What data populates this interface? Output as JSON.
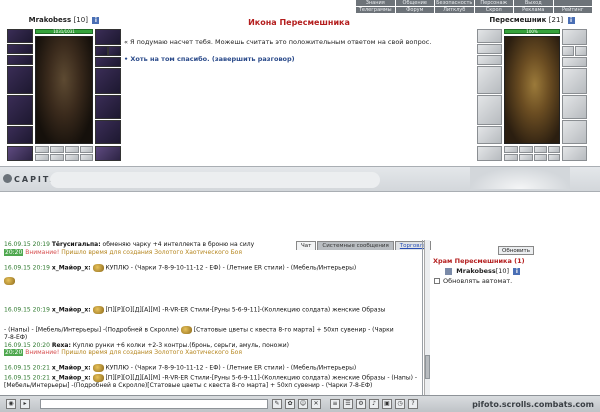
{
  "top_menu": {
    "row1": [
      "Знания",
      "Общение",
      "Безопасность",
      "Персонаж",
      "Выход",
      ""
    ],
    "row2": [
      "Телеграммы",
      "Форум",
      "Литклуб",
      "Скрол",
      "Реклама",
      "Рейтинг"
    ]
  },
  "player": {
    "name": "Mrakobess",
    "level": "[10]",
    "hp": "1031/1031",
    "info_icon": "info-icon"
  },
  "npc": {
    "name": "Пересмешник",
    "level": "[21]",
    "hp": "100%",
    "info_icon": "info-icon"
  },
  "dialog": {
    "title": "Икона Пересмешника",
    "text": "Я подумаю насчет тебя. Можешь считать это положительным ответом на свой вопрос.",
    "answer": "Хоть на том спасибо. (завершить разговор)"
  },
  "banner": {
    "logo": "CAPITALCITY"
  },
  "chat": {
    "tabs": [
      "Чат",
      "Системные сообщения",
      "Торговля"
    ],
    "messages": [
      {
        "time": "16.09.15 20:19",
        "nick": "Tёrycигaльпа:",
        "text": "обменяю чарку +4 интеллекта в броню на силу"
      },
      {
        "time": "20:20",
        "system": "Внимание!",
        "text": "Пришло время для создания Золотого Хаотического Боя"
      },
      {
        "time": "16.09.15 20:19",
        "nick": "x_Майор_x:",
        "text": "КУПЛЮ - (Чарки 7-8-9-10-11-12 - ЕФ) - (Летние ЕR стили) - (Мебель/Интерьеры)"
      },
      {
        "time": "16.09.15 20:19",
        "nick": "x_Майор_x:",
        "text": "[П][Р][О][Д][А][М] -R-VR-ER Стили-[Руны 5-6-9-11]-(Коллекцию солдата) женские Образы"
      },
      {
        "text": "- (Напы) - [Мебель/Интерьеры] -(Подробней в Скролле)"
      },
      {
        "text": "[Статовые цветы с квеста 8-го марта] + 50хп сувенир - (Чарки"
      },
      {
        "text": "7-8-ЕФ)"
      },
      {
        "time": "16.09.15 20:20",
        "nick": "Rexa:",
        "text": "Куплю рунки +6 колки +2-3 контры.(бронь, серьги, амуль, поножи)"
      },
      {
        "time": "20:20",
        "system": "Внимание!",
        "text": "Пришло время для создания Золотого Хаотического Боя"
      },
      {
        "time": "16.09.15 20:21",
        "nick": "x_Майор_x:",
        "text": "КУПЛЮ - (Чарки 7-8-9-10-11-12 - ЕФ) - (Летние ЕR стили) - (Мебель/Интерьеры)"
      },
      {
        "time": "16.09.15 20:21",
        "nick": "x_Майор_x:",
        "text": "[П][Р][О][Д][А][М] -R-VR-ER Стили-[Руны 5-6-9-11]-(Коллекцию солдата) женские Образы - (Напы) -"
      },
      {
        "text": "[Мебель/Интерьеры] -(Подробней в Скролле)[Статовые цветы с квеста 8-го марта] + 50хп сувенир - (Чарки 7-8-ЕФ)"
      }
    ]
  },
  "side": {
    "refresh_label": "Обновить",
    "room": "Храм Пересмешника (1)",
    "online_name": "Mrakobess",
    "online_level": "[10]",
    "auto_label": "Обновлять автомат."
  },
  "footer": {
    "watermark": "pifoto.scrolls.combats.com"
  }
}
